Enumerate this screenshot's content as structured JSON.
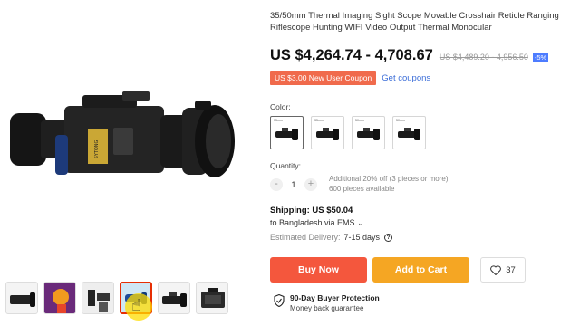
{
  "product": {
    "title": "35/50mm Thermal Imaging Sight Scope Movable Crosshair Reticle Ranging Riflescope Hunting WIFI Video Output Thermal Monocular",
    "price": "US $4,264.74 - 4,708.67",
    "old_price": "US $4,489.20 - 4,956.50",
    "discount": "-5%",
    "coupon": "US $3.00 New User Coupon",
    "get_coupons": "Get coupons",
    "color_label": "Color:",
    "color_options": [
      "35mm",
      "35mm",
      "50mm",
      "50mm"
    ],
    "quantity_label": "Quantity:",
    "quantity": "1",
    "quantity_minus": "-",
    "quantity_plus": "+",
    "quantity_info_1": "Additional 20% off (3 pieces or more)",
    "quantity_info_2": "600 pieces available",
    "shipping": "Shipping: US $50.04",
    "ship_to": "to Bangladesh via EMS",
    "delivery_label": "Estimated Delivery:",
    "delivery_value": "7-15 days",
    "buy_now": "Buy Now",
    "add_to_cart": "Add to Cart",
    "wishlist_count": "37",
    "protection_title": "90-Day Buyer Protection",
    "protection_sub": "Money back guarantee"
  },
  "gallery": {
    "thumbnail_count": 6,
    "active_index": 3
  },
  "colors": {
    "accent": "#f4573d",
    "cart": "#f5a623",
    "coupon": "#f06a4c",
    "link": "#3b6dd8",
    "discount_badge": "#4d7cff"
  }
}
